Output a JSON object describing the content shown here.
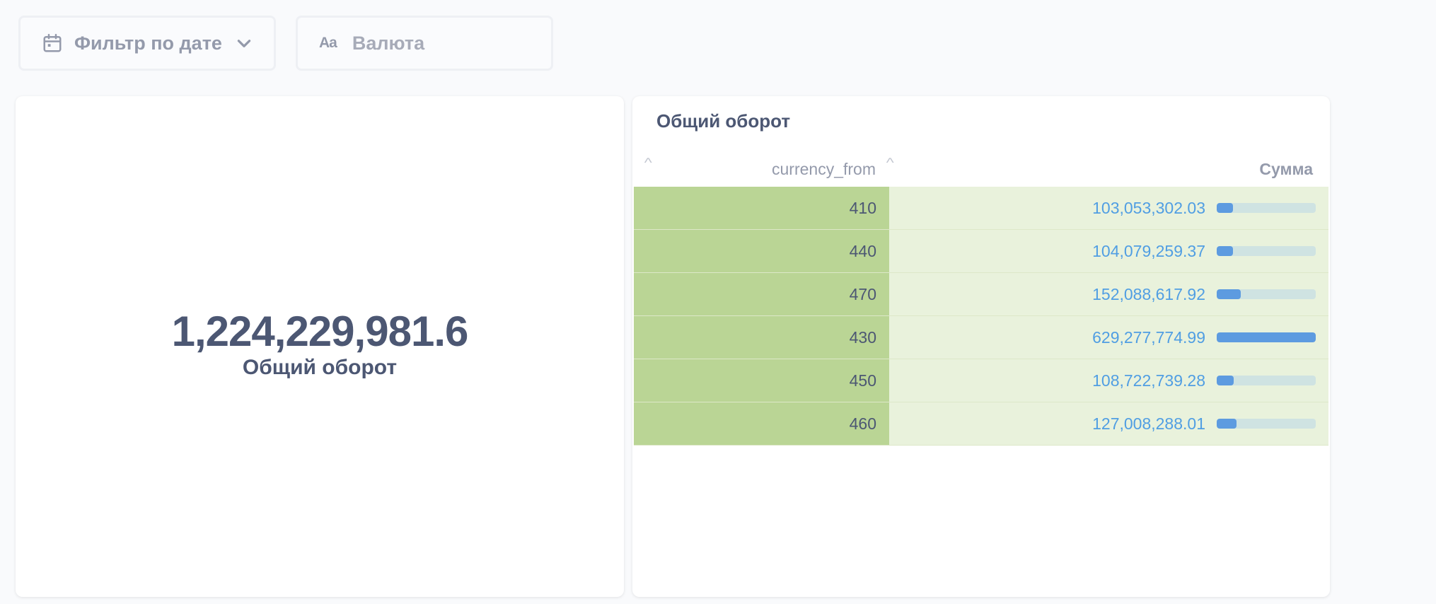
{
  "filters": {
    "date": {
      "label": "Фильтр по дате",
      "icon": "calendar-icon"
    },
    "currency": {
      "label": "Валюта",
      "icon": "text-aa-icon",
      "icon_text": "Aa"
    }
  },
  "scalar_card": {
    "value": "1,224,229,981.6",
    "title": "Общий оборот"
  },
  "table_card": {
    "title": "Общий оборот",
    "columns": [
      "currency_from",
      "Сумма"
    ],
    "rows": [
      {
        "currency_from": "410",
        "amount": "103,053,302.03",
        "amount_value": 103053302.03
      },
      {
        "currency_from": "440",
        "amount": "104,079,259.37",
        "amount_value": 104079259.37
      },
      {
        "currency_from": "470",
        "amount": "152,088,617.92",
        "amount_value": 152088617.92
      },
      {
        "currency_from": "430",
        "amount": "629,277,774.99",
        "amount_value": 629277774.99
      },
      {
        "currency_from": "450",
        "amount": "108,722,739.28",
        "amount_value": 108722739.28
      },
      {
        "currency_from": "460",
        "amount": "127,008,288.01",
        "amount_value": 127008288.01
      }
    ],
    "max_value": 629277774.99
  },
  "colors": {
    "text": "#4c5773",
    "muted": "#949aab",
    "link_blue": "#509ee3",
    "bar_fill": "#5d9be0",
    "bar_track": "#cfe3e2",
    "cell_green": "#bad595",
    "cell_light_green": "#e9f2dc"
  }
}
